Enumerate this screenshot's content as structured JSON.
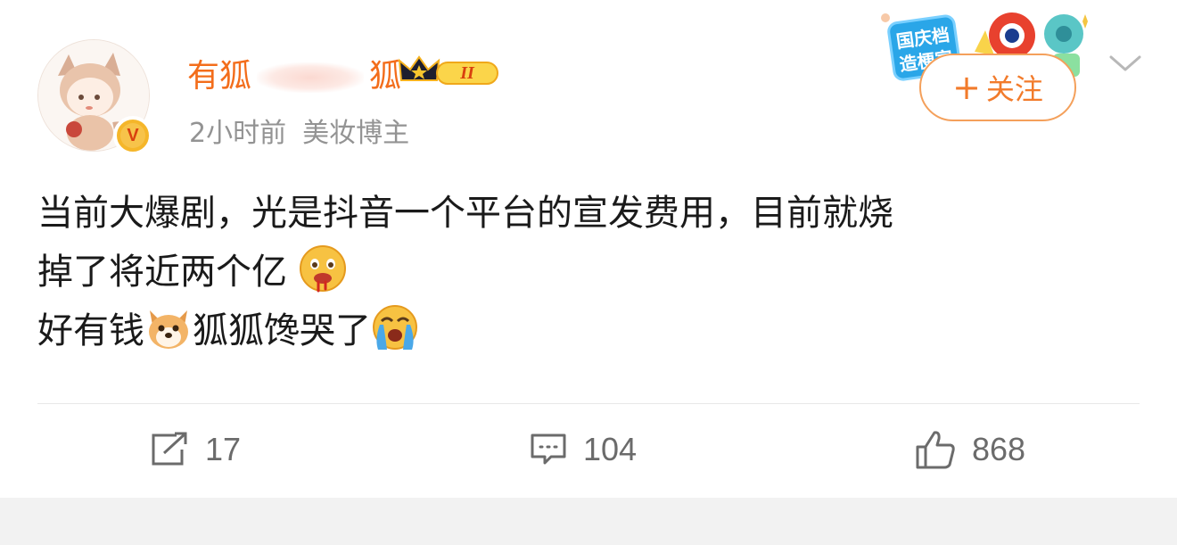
{
  "post": {
    "author": {
      "name_start": "有狐",
      "name_end": "狐",
      "level_badge": "II",
      "verified_badge": "V"
    },
    "meta": {
      "time": "2小时前",
      "tag": "美妆博主"
    },
    "follow_button": {
      "plus": "+",
      "label": "关注"
    },
    "promo_badge": {
      "line1": "国庆档",
      "line2": "造梗宣"
    },
    "content": {
      "line1": "当前大爆剧，光是抖音一个平台的宣发费用，目前就烧",
      "line2": "掉了将近两个亿",
      "line3a": "好有钱",
      "line3b": "狐狐馋哭了",
      "emojis": [
        "drooling-face-emoji",
        "dog-face-emoji",
        "crying-face-emoji"
      ]
    },
    "actions": {
      "repost_count": "17",
      "comment_count": "104",
      "like_count": "868"
    },
    "colors": {
      "username": "#f36d1b",
      "follow": "#f27b2b",
      "meta": "#939393",
      "action": "#6b6b6b"
    }
  }
}
